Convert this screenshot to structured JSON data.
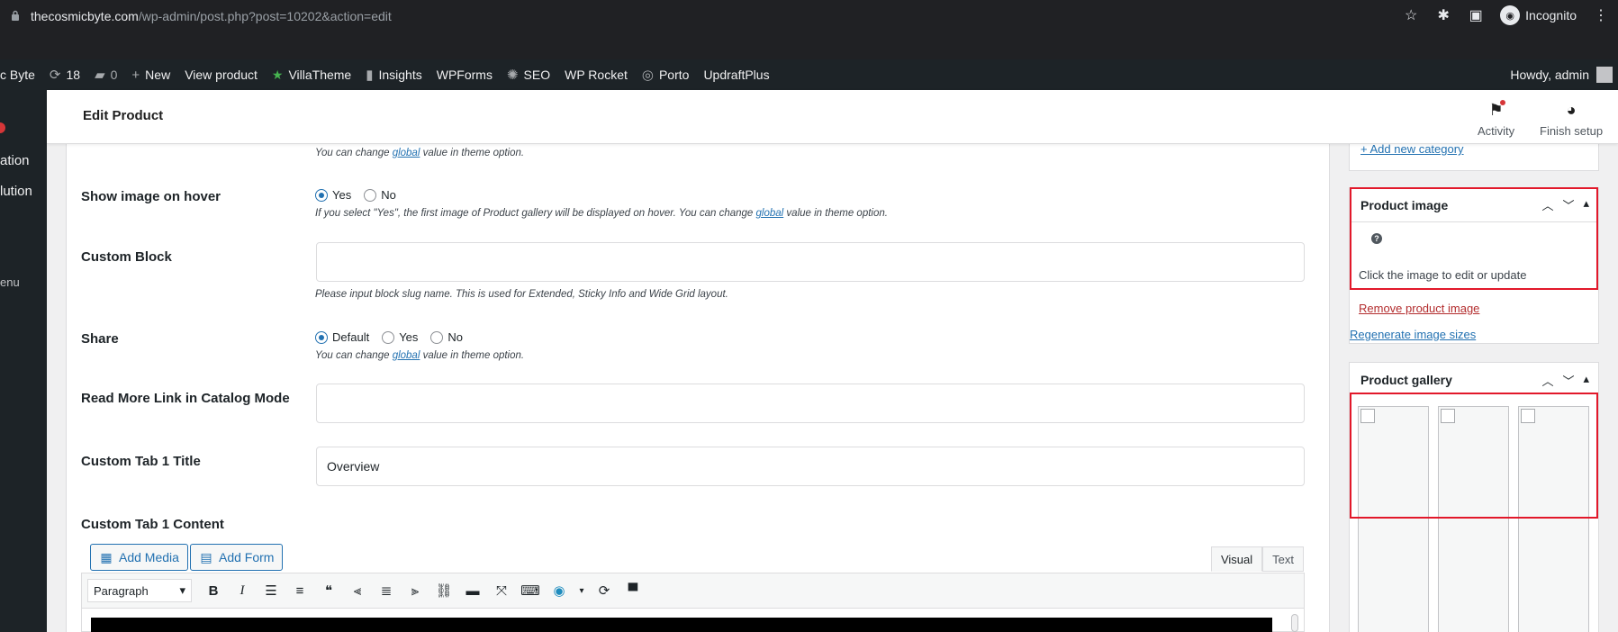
{
  "browser": {
    "url_host": "thecosmicbyte.com",
    "url_path": "/wp-admin/post.php?post=10202&action=edit",
    "profile_label": "Incognito"
  },
  "adminbar": {
    "site_name": "c Byte",
    "updates_count": "18",
    "comments_count": "0",
    "new_label": "New",
    "view_product": "View product",
    "villatheme": "VillaTheme",
    "insights": "Insights",
    "wpforms": "WPForms",
    "seo": "SEO",
    "wp_rocket": "WP Rocket",
    "porto": "Porto",
    "updraftplus": "UpdraftPlus",
    "howdy": "Howdy, admin"
  },
  "sidemenu": {
    "item1": "ation",
    "item2": "lution",
    "item3": "enu"
  },
  "header": {
    "title": "Edit Product",
    "activity": "Activity",
    "finish_setup": "Finish setup"
  },
  "form": {
    "top_note_prefix": "You can change ",
    "top_note_link": "global",
    "top_note_suffix": " value in theme option.",
    "show_image_hover": {
      "label": "Show image on hover",
      "yes": "Yes",
      "no": "No",
      "selected": "Yes",
      "note_prefix": "If you select \"Yes\", the first image of Product gallery will be displayed on hover. You can change ",
      "note_link": "global",
      "note_suffix": " value in theme option."
    },
    "custom_block": {
      "label": "Custom Block",
      "value": "",
      "note": "Please input block slug name. This is used for Extended, Sticky Info and Wide Grid layout."
    },
    "share": {
      "label": "Share",
      "default": "Default",
      "yes": "Yes",
      "no": "No",
      "selected": "Default",
      "note_prefix": "You can change ",
      "note_link": "global",
      "note_suffix": " value in theme option."
    },
    "read_more": {
      "label": "Read More Link in Catalog Mode",
      "value": ""
    },
    "tab1_title": {
      "label": "Custom Tab 1 Title",
      "value": "Overview"
    },
    "tab1_content": {
      "label": "Custom Tab 1 Content",
      "add_media": "Add Media",
      "add_form": "Add Form",
      "tab_visual": "Visual",
      "tab_text": "Text",
      "format_select": "Paragraph"
    }
  },
  "sidebar": {
    "add_new_category": "+ Add new category",
    "product_image": {
      "title": "Product image",
      "help_icon": "?",
      "hint": "Click the image to edit or update",
      "remove": "Remove product image",
      "regenerate": "Regenerate image sizes"
    },
    "product_gallery": {
      "title": "Product gallery"
    }
  },
  "colors": {
    "accent": "#2271b1",
    "highlight_outline": "#e2182a",
    "admin_bar": "#1d2327"
  }
}
